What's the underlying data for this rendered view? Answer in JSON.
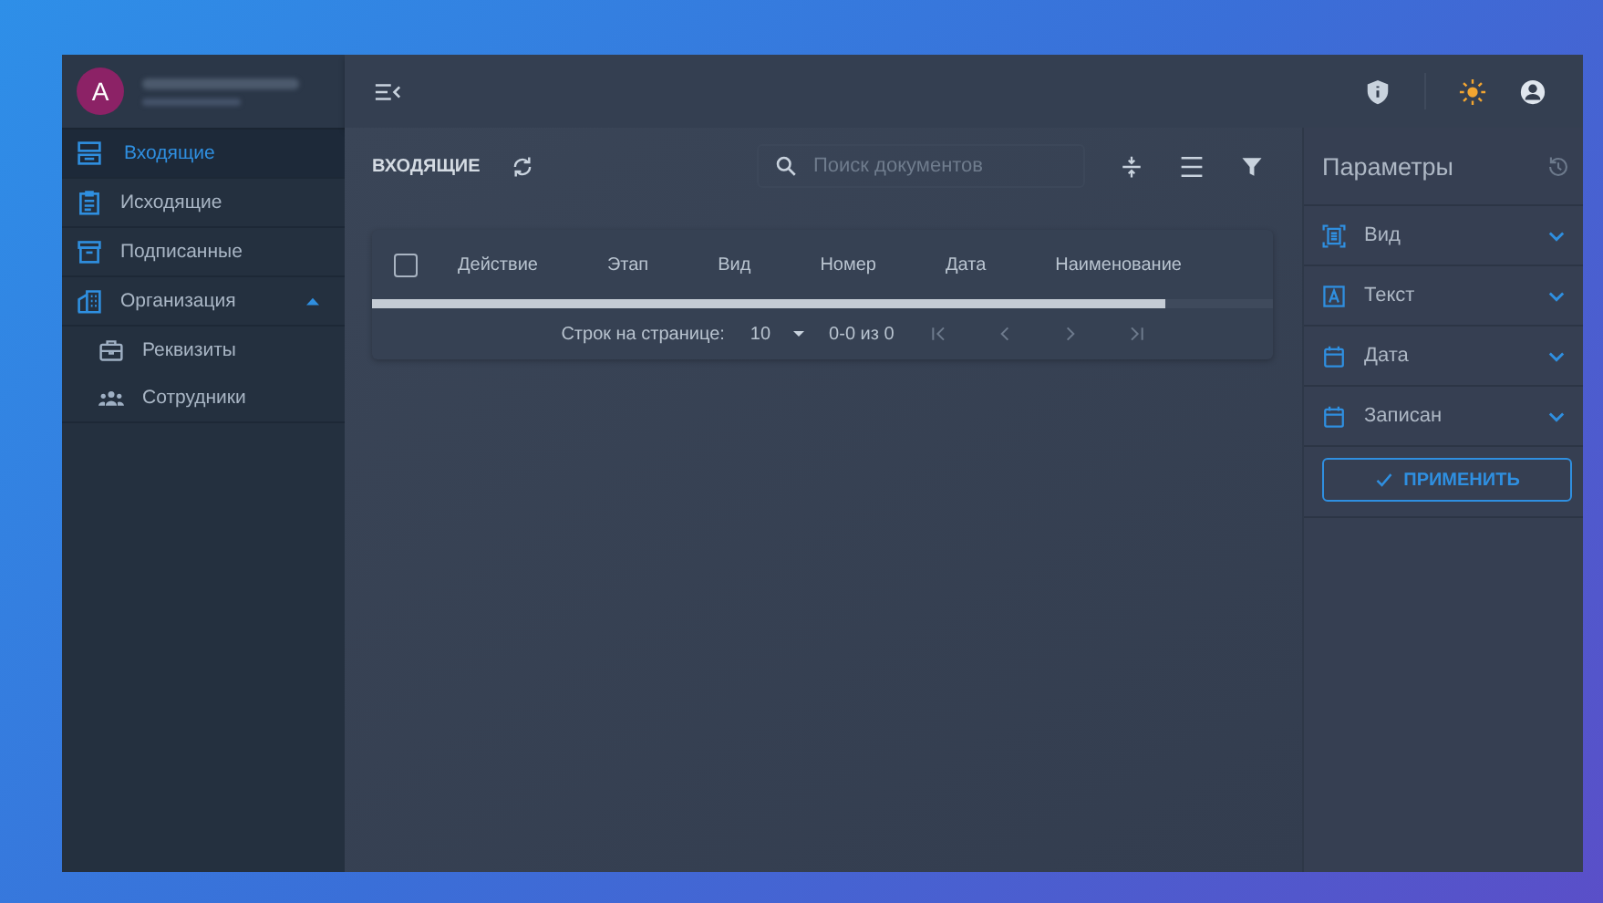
{
  "user": {
    "avatar_letter": "А"
  },
  "sidebar": {
    "items": [
      {
        "label": "Входящие",
        "kind": "inbox",
        "selected": true
      },
      {
        "label": "Исходящие",
        "kind": "doc",
        "selected": false
      },
      {
        "label": "Подписанные",
        "kind": "archive",
        "selected": false
      },
      {
        "label": "Организация",
        "kind": "building",
        "selected": false,
        "expanded": true,
        "children": [
          {
            "label": "Реквизиты",
            "kind": "case",
            "selected": false
          },
          {
            "label": "Сотрудники",
            "kind": "people",
            "selected": false
          }
        ]
      }
    ]
  },
  "toolbar": {
    "title": "ВХОДЯЩИЕ",
    "search": {
      "placeholder": "Поиск документов"
    }
  },
  "table": {
    "columns": [
      "Действие",
      "Этап",
      "Вид",
      "Номер",
      "Дата",
      "Наименование"
    ],
    "select_all_checked": false,
    "footer": {
      "rows_label": "Строк на странице:",
      "rows_value": "10",
      "range": "0-0 из 0"
    }
  },
  "params": {
    "title": "Параметры",
    "filters": [
      {
        "label": "Вид",
        "kind": "scan",
        "expanded": false
      },
      {
        "label": "Текст",
        "kind": "text",
        "expanded": false
      },
      {
        "label": "Дата",
        "kind": "calendar",
        "expanded": false
      },
      {
        "label": "Записан",
        "kind": "calendar",
        "expanded": false
      }
    ],
    "apply": "ПРИМЕНИТЬ"
  }
}
